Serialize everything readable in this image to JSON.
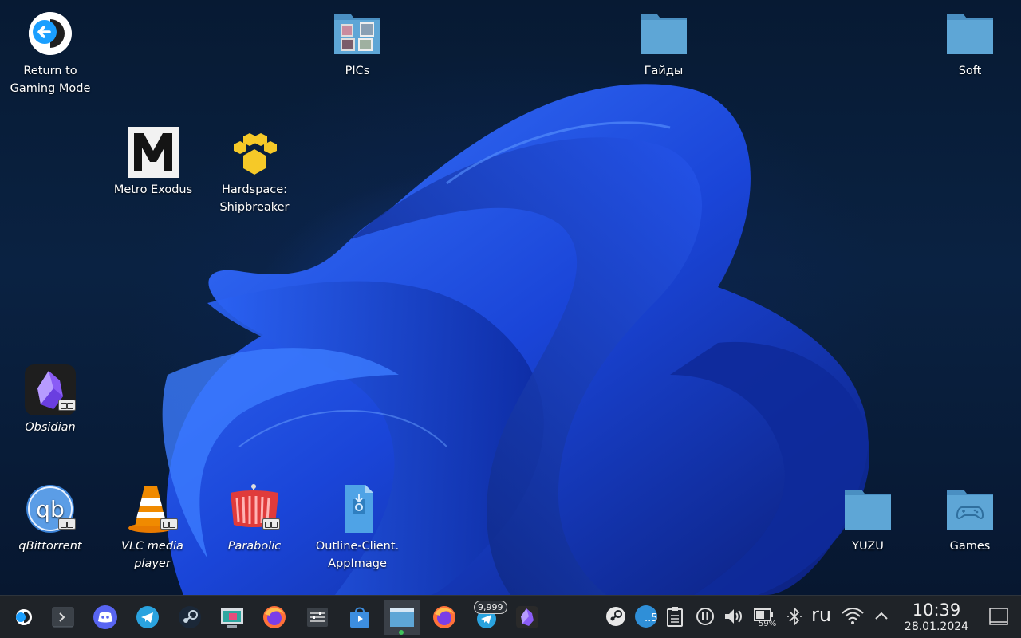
{
  "desktop": {
    "icons": {
      "return_gaming": {
        "label": "Return to\nGaming Mode",
        "icon": "return-arrow-icon"
      },
      "pics": {
        "label": "PICs",
        "icon": "folder-images-icon"
      },
      "guides": {
        "label": "Гайды",
        "icon": "folder-icon"
      },
      "soft": {
        "label": "Soft",
        "icon": "folder-icon"
      },
      "metro": {
        "label": "Metro Exodus",
        "icon": "metro-logo-icon"
      },
      "hardspace": {
        "label": "Hardspace:\nShipbreaker",
        "icon": "paw-icon"
      },
      "obsidian": {
        "label": "Obsidian",
        "icon": "obsidian-icon"
      },
      "qbittorrent": {
        "label": "qBittorrent",
        "icon": "qbittorrent-icon"
      },
      "vlc": {
        "label": "VLC media\nplayer",
        "icon": "vlc-cone-icon"
      },
      "parabolic": {
        "label": "Parabolic",
        "icon": "parabolic-icon"
      },
      "outline": {
        "label": "Outline-Client.\nAppImage",
        "icon": "appimage-file-icon"
      },
      "yuzu": {
        "label": "YUZU",
        "icon": "folder-icon"
      },
      "games": {
        "label": "Games",
        "icon": "folder-games-icon"
      }
    }
  },
  "taskbar": {
    "apps": [
      "steam-deck-menu-icon",
      "terminal-icon",
      "discord-icon",
      "telegram-icon",
      "steam-icon",
      "screenshot-tool-icon",
      "firefox-icon",
      "mixer-icon",
      "discover-store-icon",
      "file-manager-icon",
      "firefox-icon",
      "telegram-icon",
      "obsidian-icon"
    ],
    "telegram_unread": "9,999",
    "steam_tray_badge": "..5",
    "battery_percent": "59%",
    "keyboard_layout": "ru",
    "time": "10:39",
    "date": "28.01.2024"
  },
  "colors": {
    "taskbar_bg": "#1f2328",
    "folder_blue": "#5ea6d6",
    "wallpaper_blue": "#1d4fe0",
    "desktop_bg": "#071a33"
  }
}
